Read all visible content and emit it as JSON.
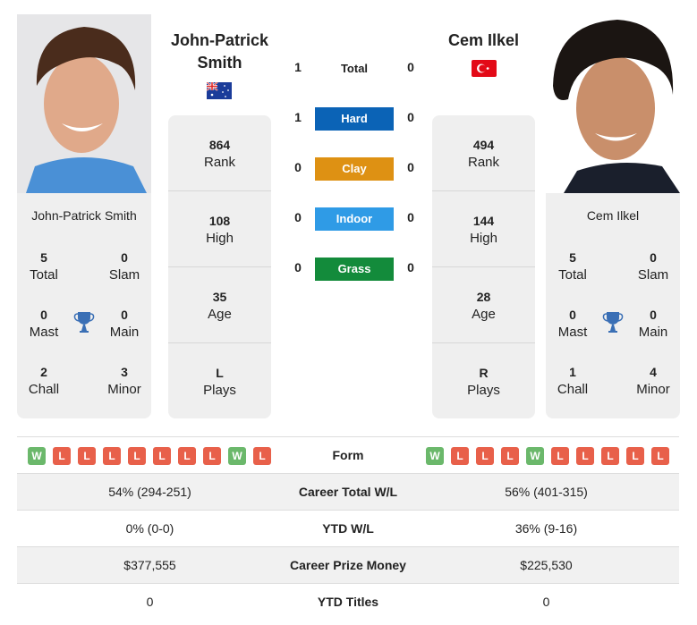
{
  "player1": {
    "name": "John-Patrick Smith",
    "name_line1": "John-Patrick",
    "name_line2": "Smith",
    "flag": "australia-flag",
    "card_name": "John-Patrick Smith",
    "titles": {
      "total": {
        "value": "5",
        "label": "Total"
      },
      "slam": {
        "value": "0",
        "label": "Slam"
      },
      "mast": {
        "value": "0",
        "label": "Mast"
      },
      "main": {
        "value": "0",
        "label": "Main"
      },
      "chall": {
        "value": "2",
        "label": "Chall"
      },
      "minor": {
        "value": "3",
        "label": "Minor"
      }
    },
    "stats": {
      "rank": {
        "value": "864",
        "label": "Rank"
      },
      "high": {
        "value": "108",
        "label": "High"
      },
      "age": {
        "value": "35",
        "label": "Age"
      },
      "plays": {
        "value": "L",
        "label": "Plays"
      }
    },
    "form": [
      "W",
      "L",
      "L",
      "L",
      "L",
      "L",
      "L",
      "L",
      "W",
      "L"
    ],
    "career_wl": "54% (294-251)",
    "ytd_wl": "0% (0-0)",
    "prize_money": "$377,555",
    "ytd_titles": "0"
  },
  "player2": {
    "name": "Cem Ilkel",
    "flag": "turkey-flag",
    "card_name": "Cem Ilkel",
    "titles": {
      "total": {
        "value": "5",
        "label": "Total"
      },
      "slam": {
        "value": "0",
        "label": "Slam"
      },
      "mast": {
        "value": "0",
        "label": "Mast"
      },
      "main": {
        "value": "0",
        "label": "Main"
      },
      "chall": {
        "value": "1",
        "label": "Chall"
      },
      "minor": {
        "value": "4",
        "label": "Minor"
      }
    },
    "stats": {
      "rank": {
        "value": "494",
        "label": "Rank"
      },
      "high": {
        "value": "144",
        "label": "High"
      },
      "age": {
        "value": "28",
        "label": "Age"
      },
      "plays": {
        "value": "R",
        "label": "Plays"
      }
    },
    "form": [
      "W",
      "L",
      "L",
      "L",
      "W",
      "L",
      "L",
      "L",
      "L",
      "L"
    ],
    "career_wl": "56% (401-315)",
    "ytd_wl": "36% (9-16)",
    "prize_money": "$225,530",
    "ytd_titles": "0"
  },
  "h2h": {
    "total": {
      "label": "Total",
      "p1": "1",
      "p2": "0"
    },
    "surfaces": [
      {
        "label": "Hard",
        "p1": "1",
        "p2": "0",
        "color": "#0b63b6"
      },
      {
        "label": "Clay",
        "p1": "0",
        "p2": "0",
        "color": "#de9113"
      },
      {
        "label": "Indoor",
        "p1": "0",
        "p2": "0",
        "color": "#2f9be6"
      },
      {
        "label": "Grass",
        "p1": "0",
        "p2": "0",
        "color": "#138b3b"
      }
    ]
  },
  "comparison": {
    "form_label": "Form",
    "career_wl_label": "Career Total W/L",
    "ytd_wl_label": "YTD W/L",
    "prize_label": "Career Prize Money",
    "ytd_titles_label": "YTD Titles"
  },
  "colors": {
    "win": "#6bb86b",
    "loss": "#e8604a",
    "trophy": "#3a6fb5"
  }
}
